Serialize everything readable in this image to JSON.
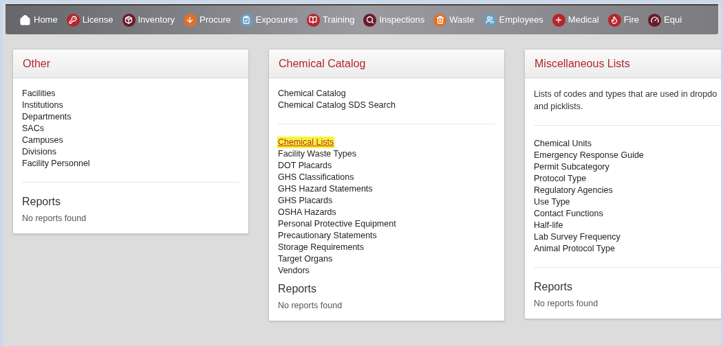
{
  "nav": [
    {
      "label": "Home"
    },
    {
      "label": "License"
    },
    {
      "label": "Inventory"
    },
    {
      "label": "Procure"
    },
    {
      "label": "Exposures"
    },
    {
      "label": "Training"
    },
    {
      "label": "Inspections"
    },
    {
      "label": "Waste"
    },
    {
      "label": "Employees"
    },
    {
      "label": "Medical"
    },
    {
      "label": "Fire"
    },
    {
      "label": "Equi"
    }
  ],
  "panels": [
    {
      "title": "Other",
      "sections": [
        {
          "kind": "links",
          "rule_above": false,
          "items": [
            {
              "label": "Facilities",
              "highlighted": false
            },
            {
              "label": "Institutions",
              "highlighted": false
            },
            {
              "label": "Departments",
              "highlighted": false
            },
            {
              "label": "SACs",
              "highlighted": false
            },
            {
              "label": "Campuses",
              "highlighted": false
            },
            {
              "label": "Divisions",
              "highlighted": false
            },
            {
              "label": "Facility Personnel",
              "highlighted": false
            }
          ]
        },
        {
          "kind": "reports",
          "rule_above": true,
          "title": "Reports",
          "empty": "No reports found"
        }
      ]
    },
    {
      "title": "Chemical Catalog",
      "sections": [
        {
          "kind": "links",
          "rule_above": false,
          "items": [
            {
              "label": "Chemical Catalog",
              "highlighted": false
            },
            {
              "label": "Chemical Catalog SDS Search",
              "highlighted": false
            }
          ]
        },
        {
          "kind": "links",
          "rule_above": true,
          "items": [
            {
              "label": "Chemical Lists",
              "highlighted": true
            },
            {
              "label": "Facility Waste Types",
              "highlighted": false
            },
            {
              "label": "DOT Placards",
              "highlighted": false
            },
            {
              "label": "GHS Classifications",
              "highlighted": false
            },
            {
              "label": "GHS Hazard Statements",
              "highlighted": false
            },
            {
              "label": "GHS Placards",
              "highlighted": false
            },
            {
              "label": "OSHA Hazards",
              "highlighted": false
            },
            {
              "label": "Personal Protective Equipment",
              "highlighted": false
            },
            {
              "label": "Precautionary Statements",
              "highlighted": false
            },
            {
              "label": "Storage Requirements",
              "highlighted": false
            },
            {
              "label": "Target Organs",
              "highlighted": false
            },
            {
              "label": "Vendors",
              "highlighted": false
            }
          ]
        },
        {
          "kind": "reports",
          "rule_above": false,
          "title": "Reports",
          "empty": "No reports found"
        }
      ]
    },
    {
      "title": "Miscellaneous Lists",
      "sections": [
        {
          "kind": "text",
          "rule_above": false,
          "lines": [
            "Lists of codes and types that are used in dropdo",
            "and picklists."
          ]
        },
        {
          "kind": "links",
          "rule_above": true,
          "items": [
            {
              "label": "Chemical Units",
              "highlighted": false
            },
            {
              "label": "Emergency Response Guide",
              "highlighted": false
            },
            {
              "label": "Permit Subcategory",
              "highlighted": false
            },
            {
              "label": "Protocol Type",
              "highlighted": false
            },
            {
              "label": "Regulatory Agencies",
              "highlighted": false
            },
            {
              "label": "Use Type",
              "highlighted": false
            },
            {
              "label": "Contact Functions",
              "highlighted": false
            },
            {
              "label": "Half-life",
              "highlighted": false
            },
            {
              "label": "Lab Survey Frequency",
              "highlighted": false
            },
            {
              "label": "Animal Protocol Type",
              "highlighted": false
            }
          ]
        },
        {
          "kind": "reports",
          "rule_above": true,
          "title": "Reports",
          "empty": "No reports found"
        }
      ]
    }
  ]
}
